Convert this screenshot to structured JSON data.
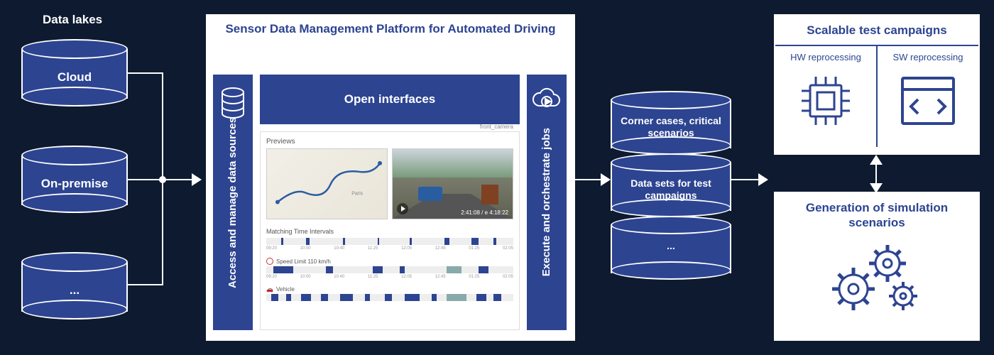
{
  "data_lakes": {
    "title": "Data lakes",
    "dbs": [
      "Cloud",
      "On-premise",
      "..."
    ]
  },
  "platform": {
    "title": "Sensor Data Management Platform for Automated Driving",
    "pillar_left": "Access and manage data sources",
    "pillar_right": "Execute and orchestrate jobs",
    "open_interfaces": "Open interfaces",
    "previews_label": "Previews",
    "camera_label": "front_camera",
    "video_time": "2:41:08 / e 4:18:22",
    "matching_title": "Matching Time Intervals",
    "rows": [
      {
        "icon": "⊘",
        "label": "Speed Limit 110 km/h"
      },
      {
        "icon": "🚗",
        "label": "Vehicle"
      }
    ],
    "tick_labels": [
      "09:20",
      "10:00",
      "10:40",
      "11:25",
      "12:05",
      "12:45",
      "01:25",
      "02:05"
    ]
  },
  "outputs": {
    "dbs": [
      "Corner cases, critical scenarios",
      "Data sets for test campaigns",
      "..."
    ]
  },
  "right": {
    "top_title": "Scalable test campaigns",
    "hw": "HW reprocessing",
    "sw": "SW reprocessing",
    "bot_title": "Generation of simulation scenarios"
  }
}
